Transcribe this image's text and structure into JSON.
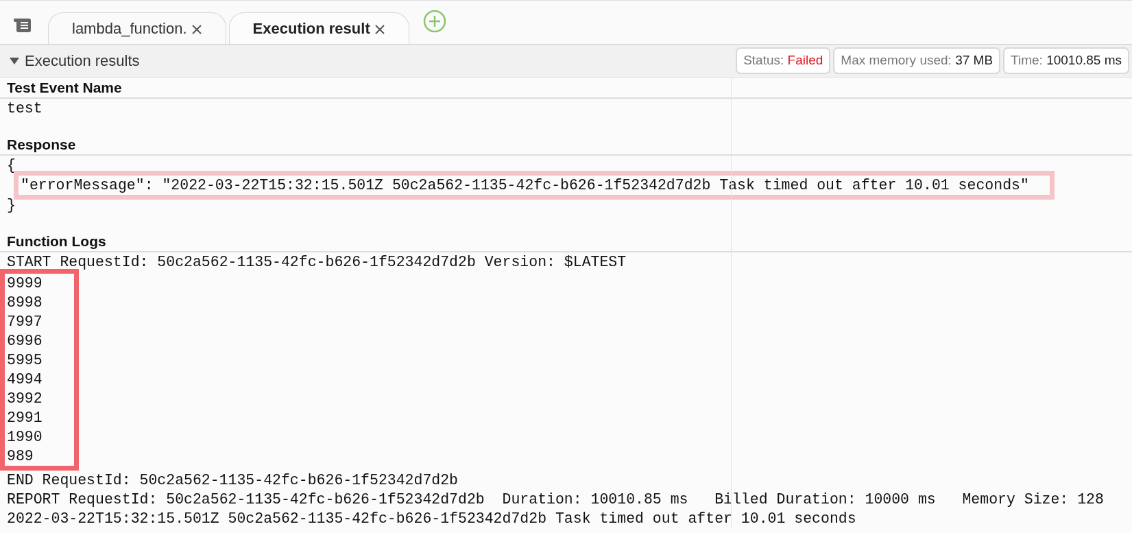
{
  "tabs": [
    {
      "label": "lambda_function.",
      "selected": false
    },
    {
      "label": "Execution result",
      "selected": true
    }
  ],
  "panel": {
    "title": "Execution results",
    "expanded": true
  },
  "stats": [
    {
      "label": "Status:",
      "value": "Failed",
      "kind": "status"
    },
    {
      "label": "Max memory used:",
      "value": "37 MB",
      "kind": "plain"
    },
    {
      "label": "Time:",
      "value": "10010.85 ms",
      "kind": "plain"
    }
  ],
  "sections": [
    {
      "heading": "Test Event Name",
      "blocks": [
        {
          "kind": "line",
          "text": "test"
        }
      ]
    },
    {
      "heading": "Response",
      "blocks": [
        {
          "kind": "line",
          "text": "{"
        },
        {
          "kind": "highlight",
          "color": "#f5c4c8",
          "lines": [
            "\"errorMessage\": \"2022-03-22T15:32:15.501Z 50c2a562-1135-42fc-b626-1f52342d7d2b Task timed out after 10.01 seconds\""
          ]
        },
        {
          "kind": "line",
          "text": "}"
        }
      ]
    },
    {
      "heading": "Function Logs",
      "blocks": [
        {
          "kind": "line",
          "text": "START RequestId: 50c2a562-1135-42fc-b626-1f52342d7d2b Version: $LATEST"
        },
        {
          "kind": "highlight",
          "color": "#f1646b",
          "lines": [
            "9999",
            "8998",
            "7997",
            "6996",
            "5995",
            "4994",
            "3992",
            "2991",
            "1990",
            "989"
          ]
        },
        {
          "kind": "line",
          "text": "END RequestId: 50c2a562-1135-42fc-b626-1f52342d7d2b"
        },
        {
          "kind": "line",
          "text": "REPORT RequestId: 50c2a562-1135-42fc-b626-1f52342d7d2b  Duration: 10010.85 ms   Billed Duration: 10000 ms   Memory Size: 128"
        },
        {
          "kind": "line",
          "text": "2022-03-22T15:32:15.501Z 50c2a562-1135-42fc-b626-1f52342d7d2b Task timed out after 10.01 seconds"
        }
      ]
    }
  ]
}
